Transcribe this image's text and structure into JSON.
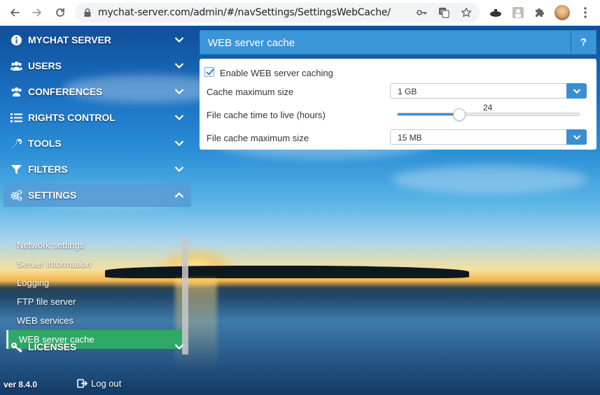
{
  "browser": {
    "url": "mychat-server.com/admin/#/navSettings/SettingsWebCache/",
    "icons": [
      "back-arrow-icon",
      "forward-arrow-icon",
      "reload-icon",
      "lock-icon",
      "key-icon",
      "translate-icon",
      "star-icon",
      "extension-icon",
      "puzzle-icon",
      "profile-avatar",
      "menu-dots-icon"
    ]
  },
  "sidebar": {
    "menu": [
      {
        "label": "MYCHAT SERVER",
        "icon": "info-icon"
      },
      {
        "label": "USERS",
        "icon": "users-icon"
      },
      {
        "label": "CONFERENCES",
        "icon": "conferences-icon"
      },
      {
        "label": "RIGHTS CONTROL",
        "icon": "list-icon"
      },
      {
        "label": "TOOLS",
        "icon": "wrench-icon"
      },
      {
        "label": "FILTERS",
        "icon": "filter-icon"
      },
      {
        "label": "SETTINGS",
        "icon": "gears-icon"
      },
      {
        "label": "LICENSES",
        "icon": "key-icon"
      }
    ],
    "settings_items": [
      "Network settings",
      "Server information",
      "Logging",
      "FTP file server",
      "WEB services",
      "WEB server cache"
    ],
    "selected_item": "WEB server cache"
  },
  "footer": {
    "version": "ver 8.4.0",
    "logout": "Log out"
  },
  "panel": {
    "title": "WEB server cache",
    "help": "?",
    "enable_label": "Enable WEB server caching",
    "enable_checked": true,
    "cache_max_label": "Cache maximum size",
    "cache_max_value": "1 GB",
    "ttl_label": "File cache time to live (hours)",
    "ttl_value": "24",
    "ttl_fraction": 0.34,
    "file_max_label": "File cache maximum size",
    "file_max_value": "15 MB"
  },
  "colors": {
    "accent": "#3a96d9",
    "selected": "#2ea866",
    "active_menu": "#569cd6"
  }
}
